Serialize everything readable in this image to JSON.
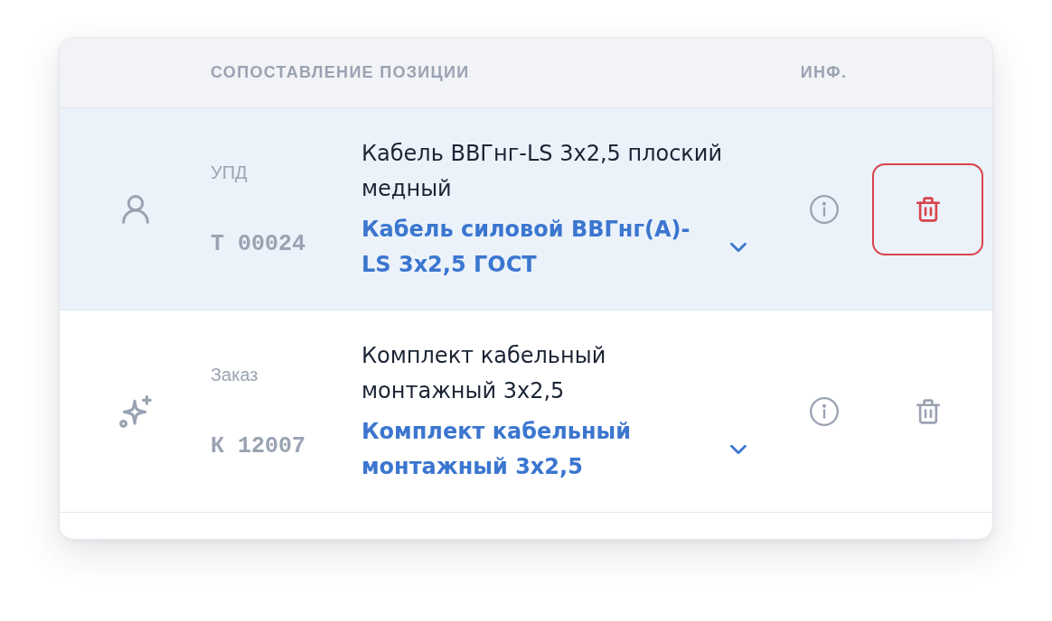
{
  "table": {
    "columns": [
      {
        "label": "СОПОСТАВЛЕНИЕ ПОЗИЦИИ"
      },
      {
        "label": "ИНФ."
      }
    ],
    "rows": [
      {
        "kind": "user",
        "selected": true,
        "document_type": "УПД",
        "document_number": "Т 00024",
        "item_name": "Кабель ВВГнг-LS 3х2,5 плоский медный",
        "matched_item": "Кабель силовой ВВГнг(А)-LS 3х2,5 ГОСТ",
        "delete_highlighted": true
      },
      {
        "kind": "ai",
        "selected": false,
        "document_type": "Заказ",
        "document_number": "К 12007",
        "item_name": "Комплект кабельный монтажный 3х2,5",
        "matched_item": "Комплект кабельный монтажный 3х2,5",
        "delete_highlighted": false
      }
    ]
  }
}
